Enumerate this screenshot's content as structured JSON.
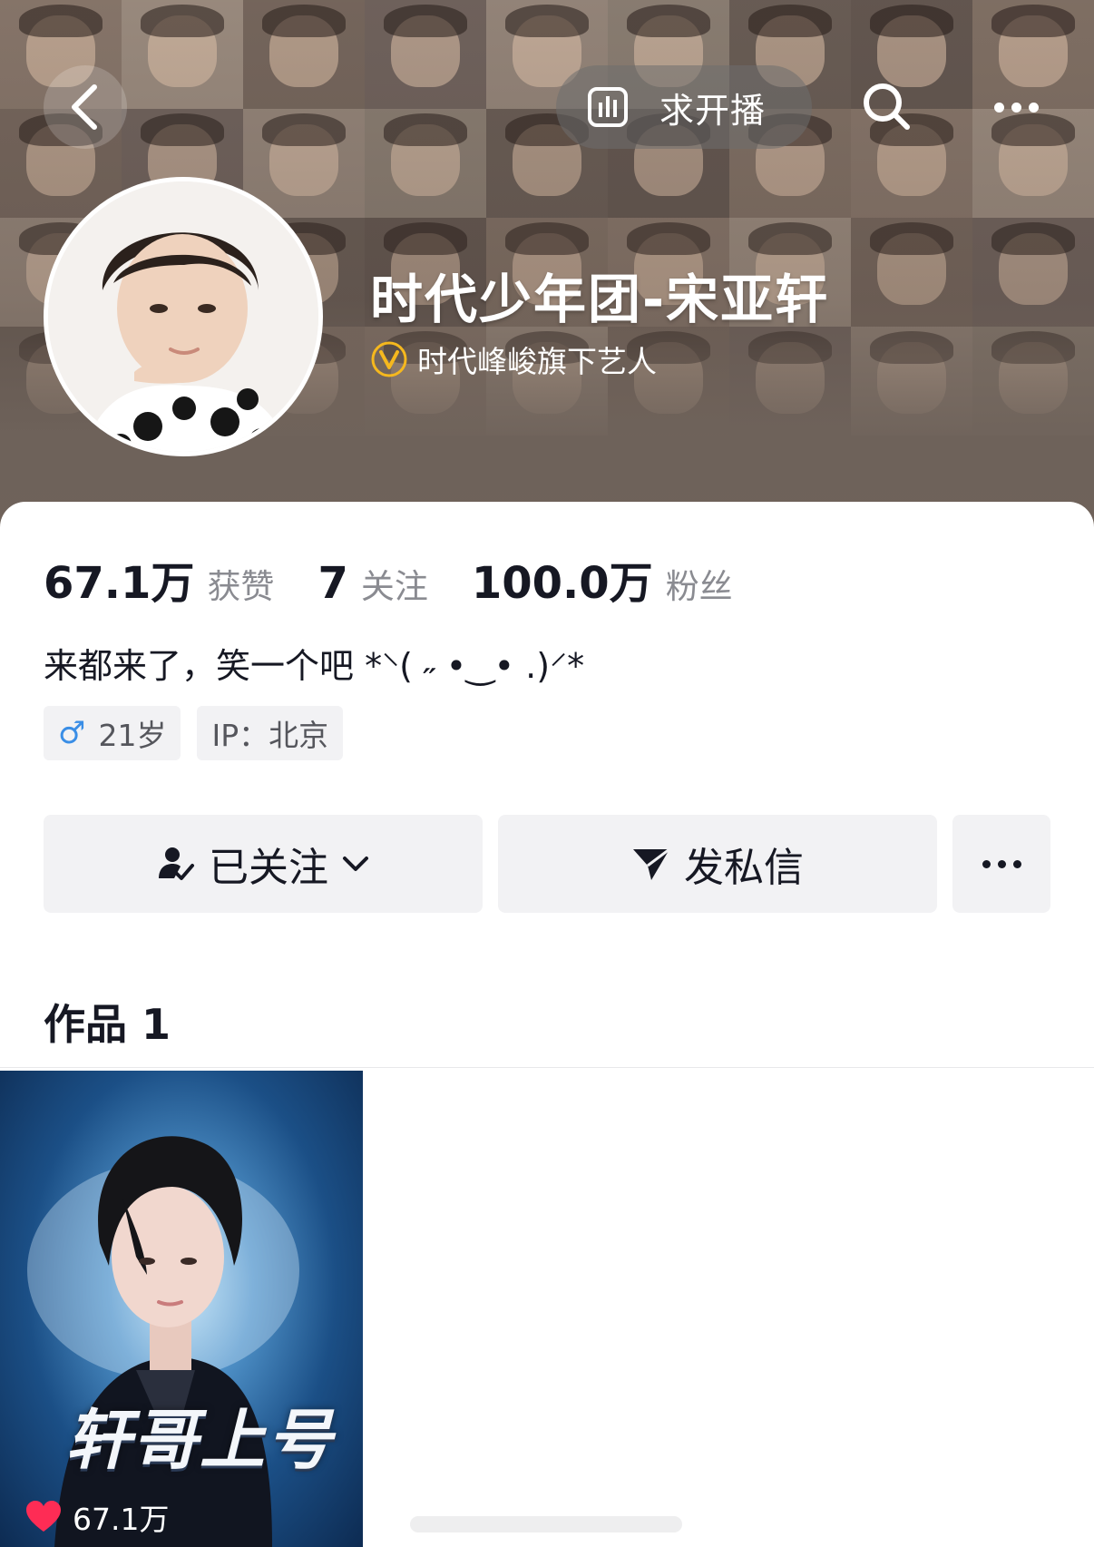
{
  "header": {
    "live_request_label": "求开播",
    "icons": {
      "back": "chevron-left-icon",
      "live": "bar-chart-icon",
      "search": "search-icon",
      "more": "ellipsis-icon"
    }
  },
  "profile": {
    "name": "时代少年团-宋亚轩",
    "verification": "时代峰峻旗下艺人",
    "stats": [
      {
        "value": "67.1万",
        "label": "获赞"
      },
      {
        "value": "7",
        "label": "关注"
      },
      {
        "value": "100.0万",
        "label": "粉丝"
      }
    ],
    "bio": "来都来了，笑一个吧 *⸌( ˶ •‿• .)⸍*",
    "tags": {
      "gender_symbol": "♂",
      "age": "21岁",
      "ip": "IP：北京"
    }
  },
  "actions": {
    "follow_label": "已关注",
    "message_label": "发私信"
  },
  "works": {
    "title": "作品 1",
    "items": [
      {
        "overlay_text": "轩哥上号",
        "likes": "67.1万"
      }
    ]
  },
  "colors": {
    "cover_base": "#6f625a",
    "like_red": "#fe2c55",
    "male_blue": "#3a8ee6",
    "verify_gold": "#f5b81e",
    "button_bg": "#f2f2f4"
  }
}
